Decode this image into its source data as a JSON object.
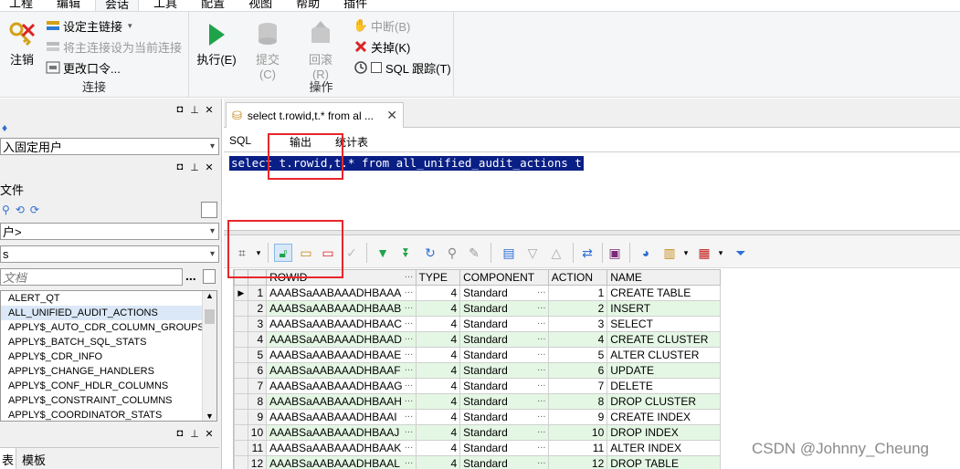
{
  "menubar": {
    "items": [
      "工程",
      "编辑",
      "会话",
      "工具",
      "配置",
      "视图",
      "帮助",
      "插件"
    ],
    "active": 2
  },
  "ribbon": {
    "connect_group": {
      "label": "连接",
      "logoff": "注销",
      "set_main": "设定主链接",
      "set_main_current": "将主连接设为当前连接",
      "change_password": "更改口令..."
    },
    "ops_group": {
      "label": "操作",
      "execute": "执行(E)",
      "commit": "提交(C)",
      "rollback": "回滚(R)",
      "break": "中断(B)",
      "close": "关掉(K)",
      "sql_trace": "SQL 跟踪(T)"
    }
  },
  "left": {
    "user_combo": "入固定用户",
    "file_label": "文件",
    "owner_combo": "户>",
    "type_combo": "s",
    "search_placeholder": "文档",
    "more": "...",
    "bottom_tabs": [
      "表",
      "模板"
    ],
    "objects": [
      "ALERT_QT",
      "ALL_UNIFIED_AUDIT_ACTIONS",
      "APPLY$_AUTO_CDR_COLUMN_GROUPS",
      "APPLY$_BATCH_SQL_STATS",
      "APPLY$_CDR_INFO",
      "APPLY$_CHANGE_HANDLERS",
      "APPLY$_CONF_HDLR_COLUMNS",
      "APPLY$_CONSTRAINT_COLUMNS",
      "APPLY$_COORDINATOR_STATS"
    ],
    "selected_index": 1
  },
  "editor": {
    "tab_title": "select t.rowid,t.* from al ...",
    "subtabs": [
      "SQL",
      "输出",
      "统计表"
    ],
    "sql": "select t.rowid,t.* from all_unified_audit_actions t"
  },
  "grid": {
    "columns": [
      "ROWID",
      "TYPE",
      "COMPONENT",
      "ACTION",
      "NAME"
    ],
    "rows": [
      [
        "1",
        "AAABSaAABAAADHBAAA",
        "4",
        "Standard",
        "1",
        "CREATE TABLE"
      ],
      [
        "2",
        "AAABSaAABAAADHBAAB",
        "4",
        "Standard",
        "2",
        "INSERT"
      ],
      [
        "3",
        "AAABSaAABAAADHBAAC",
        "4",
        "Standard",
        "3",
        "SELECT"
      ],
      [
        "4",
        "AAABSaAABAAADHBAAD",
        "4",
        "Standard",
        "4",
        "CREATE CLUSTER"
      ],
      [
        "5",
        "AAABSaAABAAADHBAAE",
        "4",
        "Standard",
        "5",
        "ALTER CLUSTER"
      ],
      [
        "6",
        "AAABSaAABAAADHBAAF",
        "4",
        "Standard",
        "6",
        "UPDATE"
      ],
      [
        "7",
        "AAABSaAABAAADHBAAG",
        "4",
        "Standard",
        "7",
        "DELETE"
      ],
      [
        "8",
        "AAABSaAABAAADHBAAH",
        "4",
        "Standard",
        "8",
        "DROP CLUSTER"
      ],
      [
        "9",
        "AAABSaAABAAADHBAAI",
        "4",
        "Standard",
        "9",
        "CREATE INDEX"
      ],
      [
        "10",
        "AAABSaAABAAADHBAAJ",
        "4",
        "Standard",
        "10",
        "DROP INDEX"
      ],
      [
        "11",
        "AAABSaAABAAADHBAAK",
        "4",
        "Standard",
        "11",
        "ALTER INDEX"
      ],
      [
        "12",
        "AAABSaAABAAADHBAAL",
        "4",
        "Standard",
        "12",
        "DROP TABLE"
      ]
    ]
  },
  "watermark": "CSDN @Johnny_Cheung",
  "colors": {
    "highlight": "#e8262a",
    "selection": "#0a1f86",
    "row_alt": "#e4f7e4"
  }
}
